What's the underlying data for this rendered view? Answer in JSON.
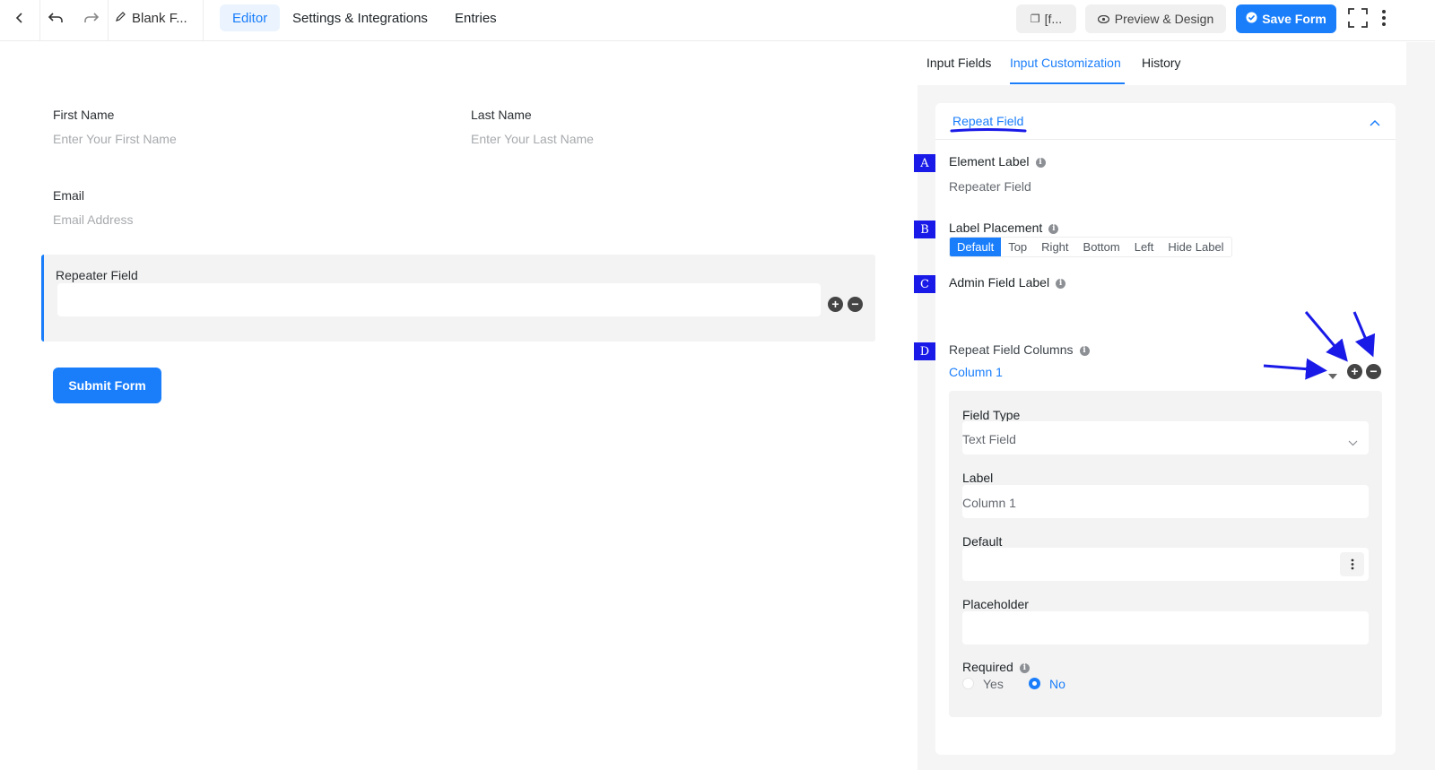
{
  "topbar": {
    "form_title": "Blank F...",
    "tabs": [
      "Editor",
      "Settings & Integrations",
      "Entries"
    ],
    "shortcode_label": "[f...",
    "preview_label": "Preview & Design",
    "save_label": "Save Form"
  },
  "form": {
    "first_name_label": "First Name",
    "first_name_placeholder": "Enter Your First Name",
    "last_name_label": "Last Name",
    "last_name_placeholder": "Enter Your Last Name",
    "email_label": "Email",
    "email_placeholder": "Email Address",
    "repeater_label": "Repeater Field",
    "submit_label": "Submit Form"
  },
  "panel": {
    "tabs": [
      "Input Fields",
      "Input Customization",
      "History"
    ],
    "section_title": "Repeat Field",
    "badges": [
      "A",
      "B",
      "C",
      "D"
    ],
    "element_label": "Element Label",
    "element_label_value": "Repeater Field",
    "label_placement": "Label Placement",
    "placement_options": [
      "Default",
      "Top",
      "Right",
      "Bottom",
      "Left",
      "Hide Label"
    ],
    "admin_field_label": "Admin Field Label",
    "repeat_columns_label": "Repeat Field Columns",
    "column_name": "Column 1",
    "field_type_label": "Field Type",
    "field_type_value": "Text Field",
    "label_label": "Label",
    "label_value": "Column 1",
    "default_label": "Default",
    "placeholder_label": "Placeholder",
    "required_label": "Required",
    "required_yes": "Yes",
    "required_no": "No"
  },
  "colors": {
    "accent": "#1a7efb",
    "badge": "#1a1ae8"
  }
}
